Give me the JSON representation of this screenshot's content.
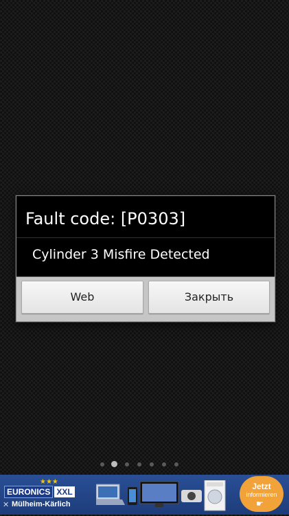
{
  "dialog": {
    "title": "Fault code: [P0303]",
    "message": "Cylinder 3 Misfire Detected",
    "buttons": {
      "web_label": "Web",
      "close_label": "Закрыть"
    }
  },
  "page_indicator": {
    "total": 7,
    "active_index": 1
  },
  "ad": {
    "brand": "EURONICS",
    "badge": "XXL",
    "location": "Mülheim-Kärlich",
    "cta_line1": "Jetzt",
    "cta_line2": "informieren",
    "close_symbol": "✕",
    "stars_symbol": "★★★",
    "colors": {
      "background": "#2a4f96",
      "cta": "#f1a33a",
      "stars": "#f6c500"
    }
  },
  "icons": {
    "ad_close": "close-icon",
    "cta_pointer": "hand-pointer-icon"
  }
}
